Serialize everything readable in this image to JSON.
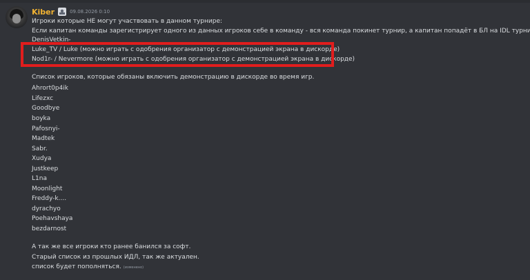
{
  "message": {
    "username": "Kiber",
    "timestamp": "09.08.2026 0:10",
    "lines_top": [
      "Игроки которые НЕ могут участвовать в данном турнире:",
      "Если капитан команды зарегистрирует одного из данных игроков себе в команду - вся команда покинет турнир, а капитан попадёт в БЛ на IDL турнирах.",
      "DenisVetkin-"
    ],
    "highlighted_lines": [
      "Luke_TV / Luke (можно играть с одобрения организатор с демонстрацией экрана в дискорде)",
      "Nod1r- / Nevermore (можно играть с одобрения организатор с демонстрацией экрана в дискорде)"
    ],
    "list_heading": "Список игроков, которые обязаны включить демонстрацию в дискорде во время игр.",
    "players": [
      "Ahrort0p4ik",
      "Lifezxc",
      "Goodbye",
      "boyka",
      "Pafosnyi-",
      "Madtek",
      "Sabr.",
      "Xudya",
      "Justkeep",
      "L1na",
      "Moonlight",
      "Freddy-k....",
      "dyrachyo",
      "Poehavshaya",
      "bezdarnost"
    ],
    "footer_lines": [
      "А так же все игроки кто ранее банился за софт.",
      "Старый список из прошлых ИДЛ, так же актуален.",
      "список будет пополняться."
    ],
    "edited_label": "(изменено)"
  },
  "colors": {
    "background": "#313338",
    "username": "#f0b232",
    "text": "#dbdee1",
    "muted": "#949ba4",
    "highlight": "#e11d1d"
  }
}
